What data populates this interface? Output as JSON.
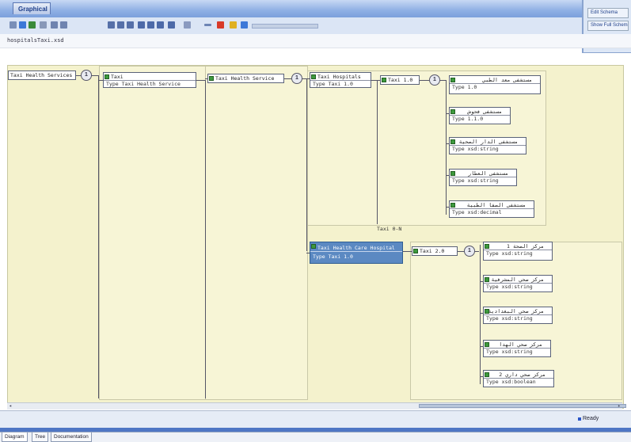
{
  "window": {
    "title_tab": "Graphical"
  },
  "side_panel": {
    "buttons": [
      "Edit Schema",
      "Show Full Schema"
    ]
  },
  "path_bar": {
    "path": "hospitalsTaxi.xsd"
  },
  "schema": {
    "root": {
      "name": "Taxi Health Services",
      "seq": "1"
    },
    "taxi": {
      "name": "Taxi",
      "type": "Type Taxi Health Service"
    },
    "taxi_health_service": {
      "name": "Taxi Health Service",
      "seq": "1"
    },
    "taxi_hospitals": {
      "name": "Taxi Hospitals",
      "type": "Type Taxi 1.0"
    },
    "taxi_1_0": {
      "name": "Taxi 1.0",
      "seq": "1"
    },
    "h_nodes": [
      {
        "name": "مستشفى  معد الطبي",
        "type": "Type  1.0"
      },
      {
        "name": "مستشفى  فحوش",
        "type": "Type  1.1.0"
      },
      {
        "name": "مستشفى  الدار الصحية",
        "type": "Type xsd:string"
      },
      {
        "name": "مستشفى  العطار",
        "type": "Type xsd:string"
      },
      {
        "name": "مستشفى  الصفا  الطبية",
        "type": "Type xsd:decimal"
      }
    ],
    "occ_label": "Taxi 0-N",
    "taxi_health_care": {
      "name": "Taxi Health Care Hospital",
      "type": "Type Taxi 1.0"
    },
    "taxi_2_0": {
      "name": "Taxi 2.0",
      "seq": "1"
    },
    "c_nodes": [
      {
        "name": "مركز  الصحة  1",
        "type": "Type xsd:string"
      },
      {
        "name": "مركز  صحي  المشرفية",
        "type": "Type xsd:string"
      },
      {
        "name": "مركز  صحي  البغدادية",
        "type": "Type xsd:string"
      },
      {
        "name": "مركز  صحي  الهدا",
        "type": "Type xsd:string"
      },
      {
        "name": "مركز  صحي  داري  2",
        "type": "Type xsd:boolean"
      }
    ]
  },
  "status": {
    "text": "Ready"
  },
  "tabs": [
    "Diagram",
    "Tree",
    "Documentation"
  ]
}
